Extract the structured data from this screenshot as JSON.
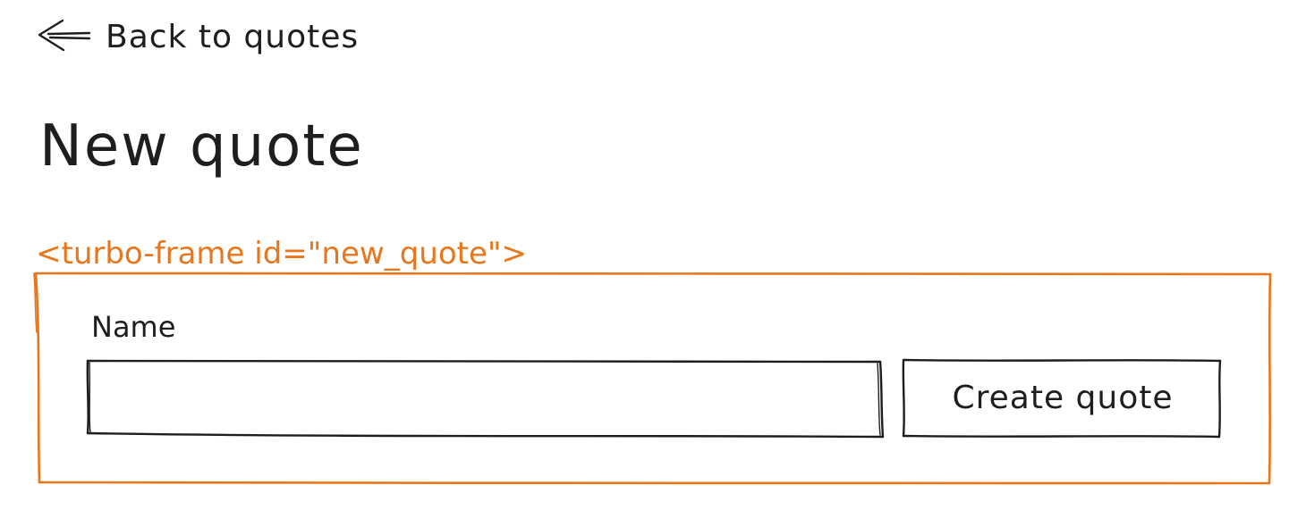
{
  "back_link": {
    "label": "Back to quotes",
    "icon": "arrow-left-icon"
  },
  "page_title": "New quote",
  "turbo_frame": {
    "tag": "<turbo-frame id=\"new_quote\">",
    "color": "#e8761c"
  },
  "form": {
    "name_label": "Name",
    "name_value": "",
    "submit_label": "Create quote"
  },
  "colors": {
    "ink": "#1e1e1e",
    "frame_accent": "#e8761c",
    "background": "#ffffff"
  }
}
